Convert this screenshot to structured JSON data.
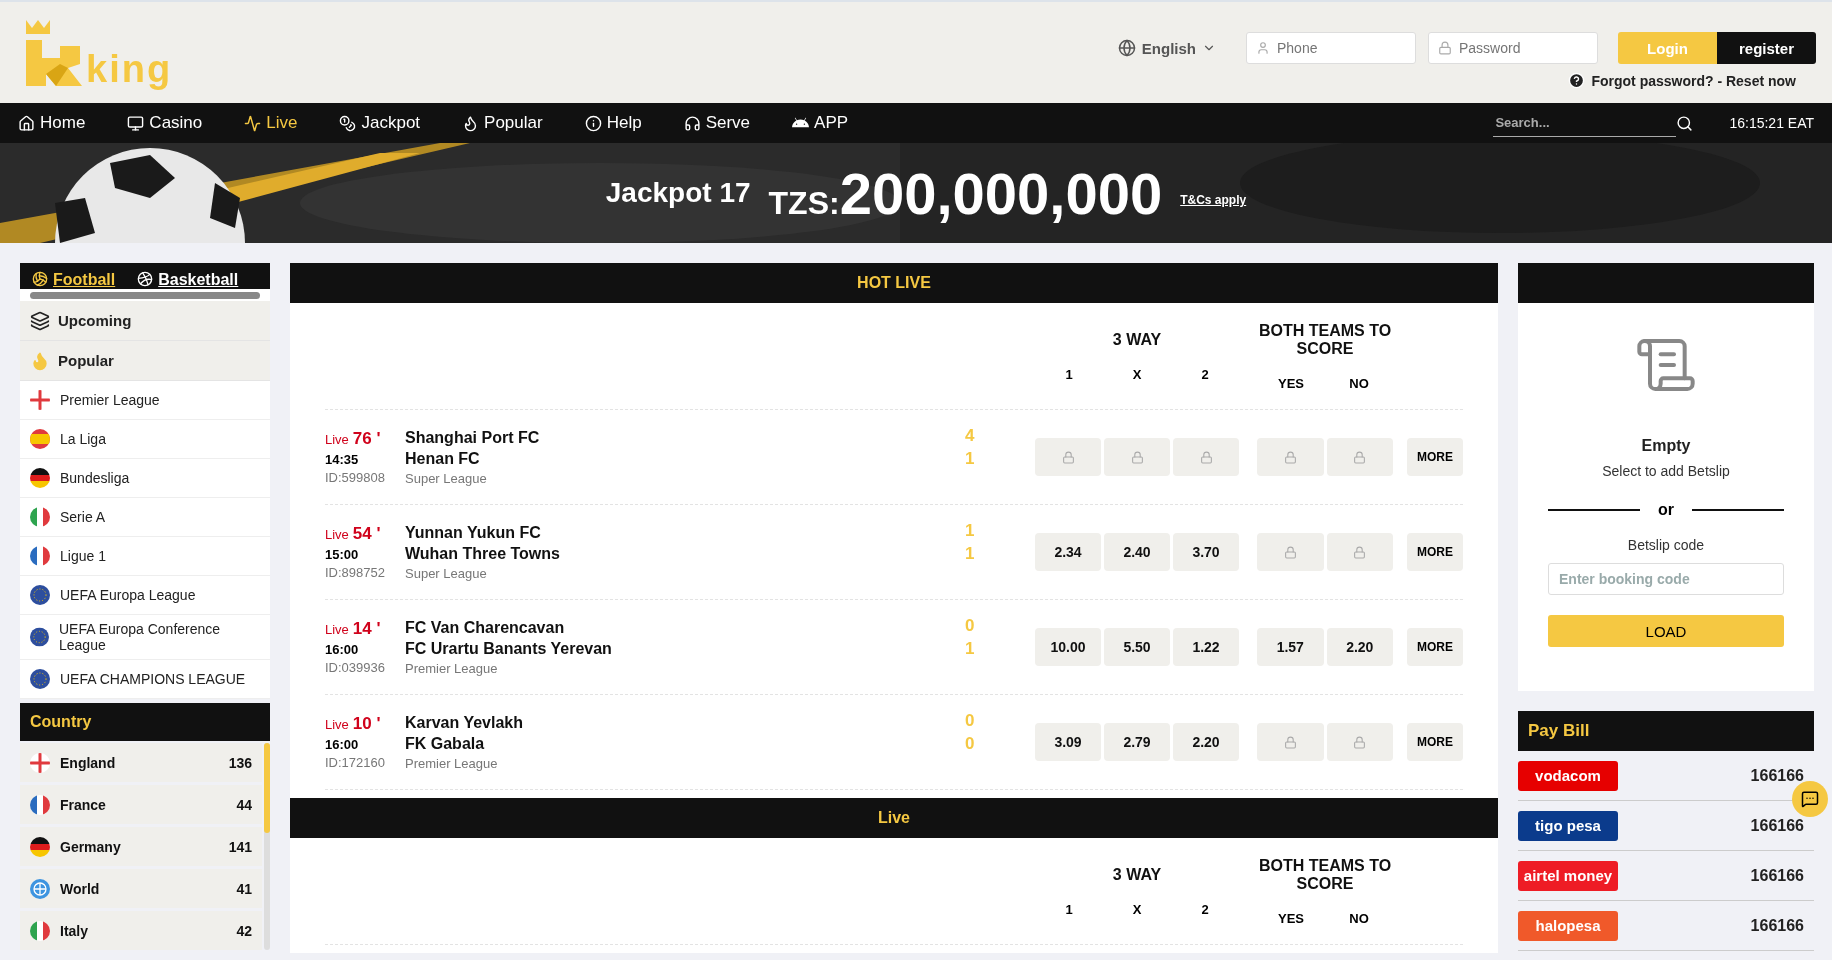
{
  "header": {
    "logo": "king",
    "language": "English",
    "phone_placeholder": "Phone",
    "password_placeholder": "Password",
    "login": "Login",
    "register": "register",
    "forgot": "Forgot password? - Reset now"
  },
  "nav": {
    "items": [
      {
        "label": "Home",
        "kind": "home",
        "selected": false
      },
      {
        "label": "Casino",
        "kind": "casino",
        "selected": false
      },
      {
        "label": "Live",
        "kind": "live",
        "selected": true
      },
      {
        "label": "Jackpot",
        "kind": "jackpot",
        "selected": false
      },
      {
        "label": "Popular",
        "kind": "popular",
        "selected": false
      },
      {
        "label": "Help",
        "kind": "help",
        "selected": false
      },
      {
        "label": "Serve",
        "kind": "serve",
        "selected": false
      },
      {
        "label": "APP",
        "kind": "app",
        "selected": false
      }
    ],
    "search_placeholder": "Search...",
    "clock": "16:15:21 EAT"
  },
  "banner": {
    "title": "Jackpot 17",
    "currency": "TZS:",
    "amount": "200,000,000",
    "terms": "T&Cs apply"
  },
  "sidebar": {
    "sports": [
      {
        "label": "Football",
        "kind": "football",
        "selected": true
      },
      {
        "label": "Basketball",
        "kind": "basketball",
        "selected": false
      }
    ],
    "sections": [
      {
        "label": "Upcoming",
        "kind": "upcoming"
      },
      {
        "label": "Popular",
        "kind": "popular"
      }
    ],
    "leagues": [
      {
        "label": "Premier League",
        "kind": "england"
      },
      {
        "label": "La Liga",
        "kind": "spain"
      },
      {
        "label": "Bundesliga",
        "kind": "germany"
      },
      {
        "label": "Serie A",
        "kind": "italy"
      },
      {
        "label": "Ligue 1",
        "kind": "france"
      },
      {
        "label": "UEFA Europa League",
        "kind": "eu"
      },
      {
        "label": "UEFA Europa Conference League",
        "kind": "eu"
      },
      {
        "label": "UEFA CHAMPIONS LEAGUE",
        "kind": "eu"
      }
    ],
    "country_title": "Country",
    "countries": [
      {
        "label": "England",
        "kind": "england",
        "count": "136"
      },
      {
        "label": "France",
        "kind": "france",
        "count": "44"
      },
      {
        "label": "Germany",
        "kind": "germany",
        "count": "141"
      },
      {
        "label": "World",
        "kind": "world",
        "count": "41"
      },
      {
        "label": "Italy",
        "kind": "italy",
        "count": "42"
      }
    ]
  },
  "sections": [
    {
      "title": "HOT LIVE",
      "group_1": "3 WAY",
      "group_2": "BOTH TEAMS TO SCORE",
      "columns": [
        "1",
        "X",
        "2",
        "YES",
        "NO"
      ],
      "matches": [
        {
          "live": "Live",
          "minute": "76",
          "tick": "'",
          "time": "14:35",
          "id": "ID:599808",
          "home": "Shanghai Port FC",
          "away": "Henan FC",
          "league": "Super League",
          "score_home": "4",
          "score_away": "1",
          "odds": [
            {
              "locked": true
            },
            {
              "locked": true
            },
            {
              "locked": true
            },
            {
              "locked": true
            },
            {
              "locked": true
            }
          ],
          "more": "MORE"
        },
        {
          "live": "Live",
          "minute": "54",
          "tick": "'",
          "time": "15:00",
          "id": "ID:898752",
          "home": "Yunnan Yukun FC",
          "away": "Wuhan Three Towns",
          "league": "Super League",
          "score_home": "1",
          "score_away": "1",
          "odds": [
            {
              "locked": false,
              "value": "2.34"
            },
            {
              "locked": false,
              "value": "2.40"
            },
            {
              "locked": false,
              "value": "3.70"
            },
            {
              "locked": true
            },
            {
              "locked": true
            }
          ],
          "more": "MORE"
        },
        {
          "live": "Live",
          "minute": "14",
          "tick": "'",
          "time": "16:00",
          "id": "ID:039936",
          "home": "FC Van Charencavan",
          "away": "FC Urartu Banants Yerevan",
          "league": "Premier League",
          "score_home": "0",
          "score_away": "1",
          "odds": [
            {
              "locked": false,
              "value": "10.00"
            },
            {
              "locked": false,
              "value": "5.50"
            },
            {
              "locked": false,
              "value": "1.22"
            },
            {
              "locked": false,
              "value": "1.57"
            },
            {
              "locked": false,
              "value": "2.20"
            }
          ],
          "more": "MORE"
        },
        {
          "live": "Live",
          "minute": "10",
          "tick": "'",
          "time": "16:00",
          "id": "ID:172160",
          "home": "Karvan Yevlakh",
          "away": "FK Gabala",
          "league": "Premier League",
          "score_home": "0",
          "score_away": "0",
          "odds": [
            {
              "locked": false,
              "value": "3.09"
            },
            {
              "locked": false,
              "value": "2.79"
            },
            {
              "locked": false,
              "value": "2.20"
            },
            {
              "locked": true
            },
            {
              "locked": true
            }
          ],
          "more": "MORE"
        }
      ]
    },
    {
      "title": "Live",
      "group_1": "3 WAY",
      "group_2": "BOTH TEAMS TO SCORE",
      "columns": [
        "1",
        "X",
        "2",
        "YES",
        "NO"
      ]
    }
  ],
  "betslip": {
    "title": "Empty",
    "subtitle": "Select to add Betslip",
    "or": "or",
    "code_label": "Betslip code",
    "code_placeholder": "Enter booking code",
    "load": "LOAD"
  },
  "pay_bill": {
    "title": "Pay Bill",
    "providers": [
      {
        "logo": "vodacom",
        "color": "#e60000",
        "number": "166166"
      },
      {
        "logo": "tigo pesa",
        "color": "#0b3b8c",
        "number": "166166"
      },
      {
        "logo": "airtel money",
        "color": "#ee1c25",
        "number": "166166"
      },
      {
        "logo": "halopesa",
        "color": "#f0592a",
        "number": "166166"
      }
    ]
  }
}
